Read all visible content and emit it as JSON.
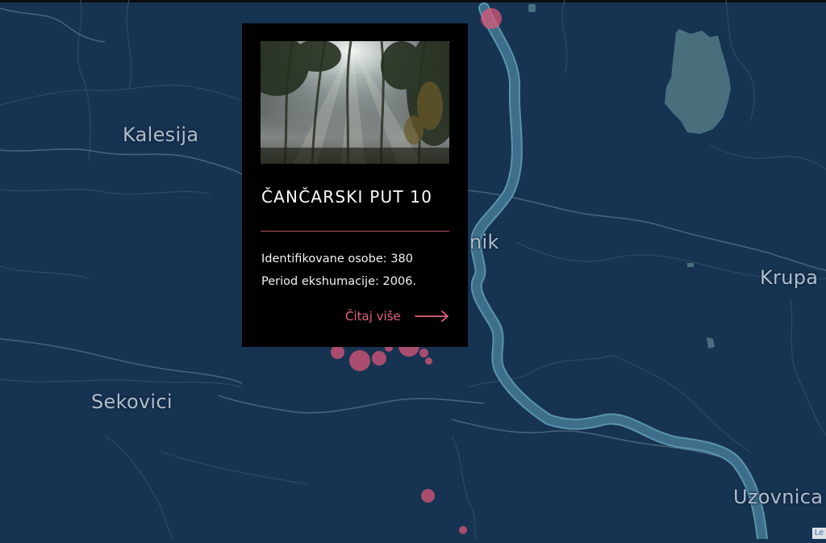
{
  "map": {
    "colors": {
      "background": "#173352",
      "river": "#3d6f8a",
      "river_edge": "#5a94ad",
      "lake": "#4a6f7c",
      "road": "#4a6178",
      "border": "#2a4864",
      "label": "#aebdcc",
      "marker": "#e15878"
    },
    "labels": {
      "kalesija": "Kalesija",
      "sekovici": "Sekovici",
      "zvornik_fragment": "nik",
      "krupa": "Krupa",
      "uzovnica": "Uzovnica"
    },
    "attribution": "Le"
  },
  "popup": {
    "title": "ČANČARSKI PUT 10",
    "identified_label": "Identifikovane osobe: 380",
    "period_label": "Period ekshumacije: 2006.",
    "read_more": "Čitaj više",
    "accent_color": "#e4647c",
    "photo_icon": "forest-photo",
    "arrow_icon": "arrow-right-icon"
  }
}
